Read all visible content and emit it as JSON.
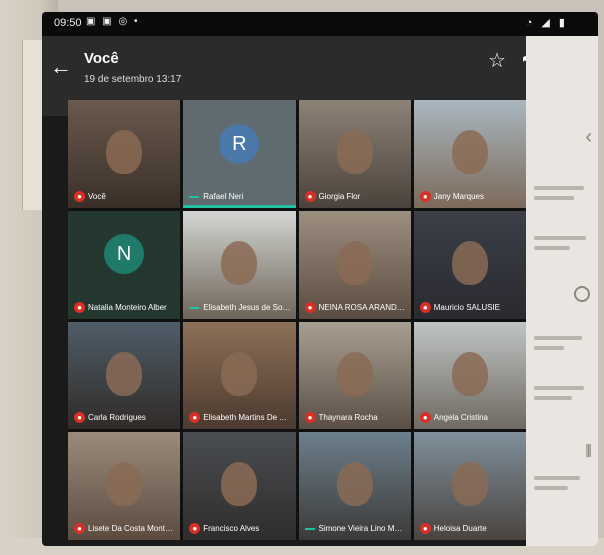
{
  "status_bar": {
    "time": "09:50",
    "left_icons": "▣ ▣ ◎ •",
    "right_icons": "◔ ◢ ▮"
  },
  "header": {
    "title": "Você",
    "subtitle": "19 de setembro 13:17",
    "icons": [
      "back-arrow-icon",
      "star-icon",
      "share-icon",
      "more-vert-icon"
    ]
  },
  "participants": [
    {
      "name": "Você",
      "type": "video",
      "muted": true
    },
    {
      "name": "Rafael Neri",
      "type": "avatar",
      "initial": "R",
      "avatar_color": "#4a78a8",
      "muted": false,
      "speaking": true
    },
    {
      "name": "Giorgia Flor",
      "type": "video",
      "muted": true
    },
    {
      "name": "Jany Marques",
      "type": "video",
      "muted": true
    },
    {
      "name": "Natalia Monteiro Alber",
      "type": "avatar",
      "initial": "N",
      "avatar_color": "#1f7a6a",
      "muted": true
    },
    {
      "name": "Elisabeth Jesus de Souza",
      "type": "video",
      "muted": false
    },
    {
      "name": "NEINA ROSA ARANDES",
      "type": "video",
      "muted": true
    },
    {
      "name": "Mauricio SALUSIE",
      "type": "video",
      "muted": true
    },
    {
      "name": "Carla Rodrigues",
      "type": "video",
      "muted": true
    },
    {
      "name": "Elisabeth Martins De Araújo",
      "type": "video",
      "muted": true
    },
    {
      "name": "Thaynara Rocha",
      "type": "video",
      "muted": true
    },
    {
      "name": "Angela Cristina",
      "type": "video",
      "muted": true
    },
    {
      "name": "Lisete Da Costa Monteiro",
      "type": "video",
      "muted": true
    },
    {
      "name": "Francisco Alves",
      "type": "video",
      "muted": true
    },
    {
      "name": "Simone Vieira Lino Mesonih...",
      "type": "video",
      "muted": false
    },
    {
      "name": "Heloisa Duarte",
      "type": "video",
      "muted": true
    }
  ]
}
